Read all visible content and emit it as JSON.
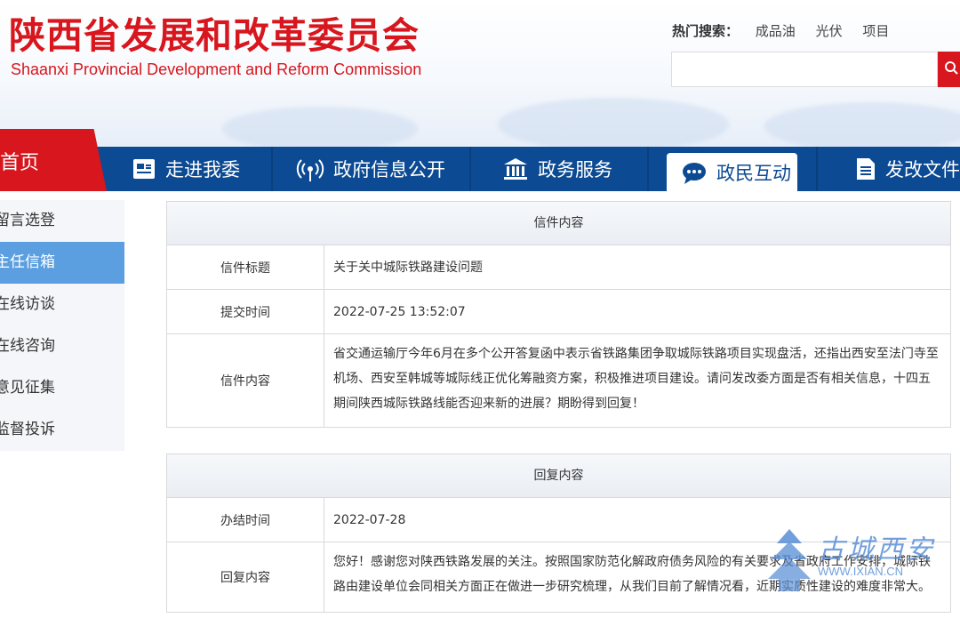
{
  "header": {
    "title": "陕西省发展和改革委员会",
    "subtitle": "Shaanxi Provincial Development and Reform Commission",
    "hot_search_label": "热门搜索：",
    "hot_search_items": [
      "成品油",
      "光伏",
      "项目"
    ]
  },
  "nav": {
    "home": "首页",
    "items": [
      {
        "label": "走进我委",
        "icon": "id-card-icon"
      },
      {
        "label": "政府信息公开",
        "icon": "broadcast-icon"
      },
      {
        "label": "政务服务",
        "icon": "building-icon"
      },
      {
        "label": "政民互动",
        "icon": "chat-icon",
        "active": true
      },
      {
        "label": "发改文件",
        "icon": "document-icon"
      }
    ]
  },
  "sidebar": {
    "items": [
      "留言选登",
      "主任信箱",
      "在线访谈",
      "在线咨询",
      "意见征集",
      "监督投诉"
    ],
    "active_index": 1
  },
  "letter": {
    "heading": "信件内容",
    "title_label": "信件标题",
    "title_value": "关于关中城际铁路建设问题",
    "time_label": "提交时间",
    "time_value": "2022-07-25 13:52:07",
    "content_label": "信件内容",
    "content_value": "省交通运输厅今年6月在多个公开答复函中表示省铁路集团争取城际铁路项目实现盘活，还指出西安至法门寺至机场、西安至韩城等城际线正优化筹融资方案，积极推进项目建设。请问发改委方面是否有相关信息，十四五期间陕西城际铁路线能否迎来新的进展？期盼得到回复！"
  },
  "reply": {
    "heading": "回复内容",
    "time_label": "办结时间",
    "time_value": "2022-07-28",
    "content_label": "回复内容",
    "content_value": "您好！感谢您对陕西铁路发展的关注。按照国家防范化解政府债务风险的有关要求及省政府工作安排，城际铁路由建设单位会同相关方面正在做进一步研究梳理，从我们目前了解情况看，近期实质性建设的难度非常大。"
  },
  "watermark": {
    "name": "古城西安",
    "url": "WWW.IXIAN.CN"
  },
  "colors": {
    "brand_red": "#d7161d",
    "nav_blue": "#0c4b93",
    "sidebar_active": "#5b9fe0"
  }
}
